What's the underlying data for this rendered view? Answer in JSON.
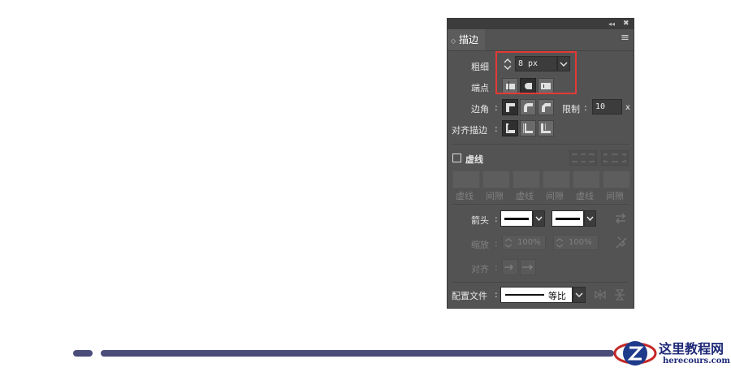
{
  "panel": {
    "title": "描边",
    "collapse_glyph": "◂◂",
    "close_glyph": "✖",
    "tab_glyph": "◇",
    "menu_glyph": "≡"
  },
  "weight": {
    "label": "粗细",
    "value": "8 px"
  },
  "cap": {
    "label": "端点"
  },
  "corner": {
    "label": "边角",
    "limit_label": "限制",
    "limit_value": "10",
    "limit_unit": "x"
  },
  "align": {
    "label": "对齐描边"
  },
  "dashed": {
    "label": "虚线",
    "checked": false,
    "fields": [
      "虚线",
      "间隙",
      "虚线",
      "间隙",
      "虚线",
      "间隙"
    ]
  },
  "arrows": {
    "label": "箭头",
    "scale_label": "缩放",
    "scale_start": "100%",
    "scale_end": "100%",
    "align_label": "对齐"
  },
  "profile": {
    "label": "配置文件",
    "value": "等比"
  },
  "colors": {
    "panel": "#535353",
    "highlight": "#e53935",
    "bar": "#4a4c7a"
  },
  "watermark": {
    "title": "这里教程网",
    "url": "herecours.com"
  }
}
